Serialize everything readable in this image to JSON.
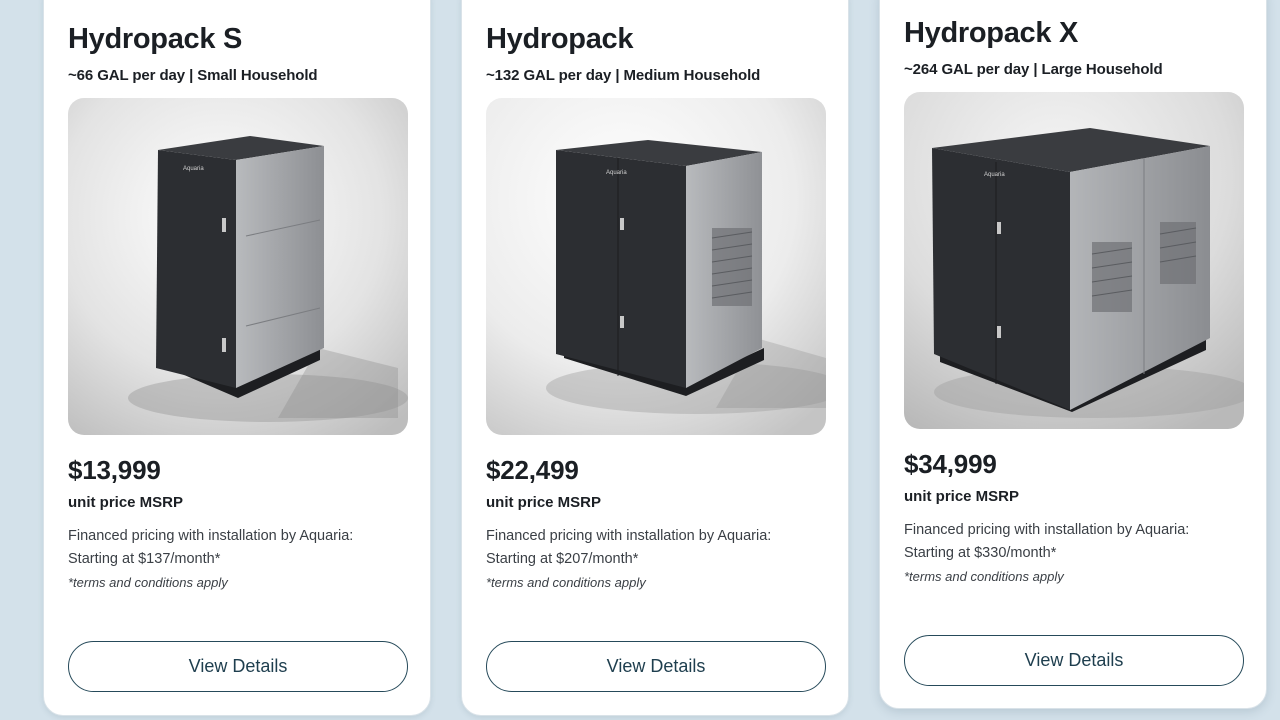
{
  "products": [
    {
      "name": "Hydropack S",
      "capacity": "~66 GAL per day | Small Household",
      "image_icon": "water-unit-small-image",
      "price": "$13,999",
      "price_label": "unit price MSRP",
      "finance_text": "Financed pricing with installation by Aquaria:",
      "monthly": "Starting at $137/month*",
      "terms": "*terms and conditions apply",
      "button_label": "View Details"
    },
    {
      "name": "Hydropack",
      "capacity": "~132 GAL per day | Medium Household",
      "image_icon": "water-unit-medium-image",
      "price": "$22,499",
      "price_label": "unit price MSRP",
      "finance_text": "Financed pricing with installation by Aquaria:",
      "monthly": "Starting at $207/month*",
      "terms": "*terms and conditions apply",
      "button_label": "View Details"
    },
    {
      "name": "Hydropack X",
      "capacity": "~264 GAL per day | Large Household",
      "image_icon": "water-unit-large-image",
      "price": "$34,999",
      "price_label": "unit price MSRP",
      "finance_text": "Financed pricing with installation by Aquaria:",
      "monthly": "Starting at $330/month*",
      "terms": "*terms and conditions apply",
      "button_label": "View Details"
    }
  ],
  "brand_logo_text": "Aquaria",
  "colors": {
    "page_background": "#d3e1ea",
    "card_background": "#ffffff",
    "button_border": "#264a5a",
    "unit_dark": "#2b2d31",
    "unit_light": "#9a9ca0"
  }
}
